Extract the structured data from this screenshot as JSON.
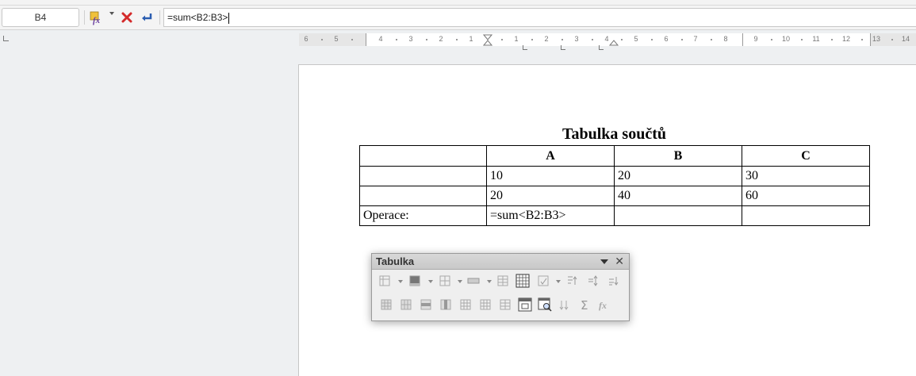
{
  "formula_bar": {
    "name_box": "B4",
    "formula": "=sum<B2:B3>"
  },
  "ruler": {
    "labels": [
      "6",
      "5",
      "4",
      "3",
      "2",
      "1",
      "1",
      "2",
      "3",
      "4",
      "5",
      "6",
      "7",
      "8",
      "9",
      "10",
      "11",
      "12",
      "13",
      "14"
    ]
  },
  "document": {
    "table_title": "Tabulka součtů",
    "header": [
      "",
      "A",
      "B",
      "C"
    ],
    "rows": [
      [
        "",
        "10",
        "20",
        "30"
      ],
      [
        "",
        "20",
        "40",
        "60"
      ],
      [
        "Operace:",
        "=sum<B2:B3>",
        "",
        ""
      ]
    ]
  },
  "toolbar_panel": {
    "title": "Tabulka"
  }
}
